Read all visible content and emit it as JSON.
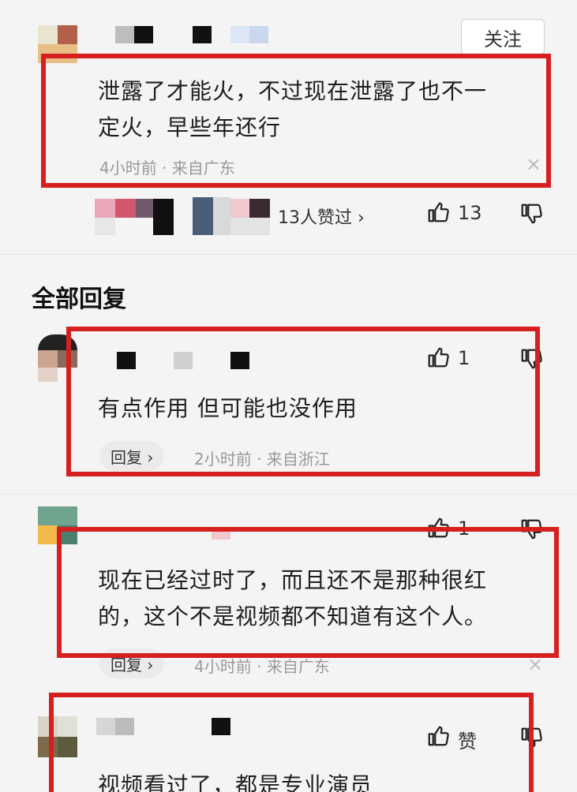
{
  "header": {
    "follow_label": "关注"
  },
  "main_comment": {
    "text_line1": "泄露了才能火，不过现在泄露了也不一",
    "text_line2": "定火，早些年还行",
    "meta": "4小时前 · 来自广东",
    "close": "×",
    "liked_by": "13人赞过 ›",
    "like_count": "13"
  },
  "replies_section": {
    "title": "全部回复"
  },
  "replies": [
    {
      "text": "有点作用 但可能也没作用",
      "reply_label": "回复 ›",
      "meta": "2小时前 · 来自浙江",
      "like_count": "1"
    },
    {
      "text_line1": "现在已经过时了，而且还不是那种很红",
      "text_line2": "的，这个不是视频都不知道有这个人。",
      "reply_label": "回复 ›",
      "meta": "4小时前 · 来自广东",
      "like_count": "1",
      "close": "×"
    },
    {
      "text": "视频看过了，都是专业演员",
      "like_label": "赞"
    }
  ],
  "colors": {
    "highlight_border": "#d61f1f",
    "background": "#f4f4f4"
  },
  "icons": [
    "thumbs-up-icon",
    "thumbs-down-icon",
    "close-icon",
    "chevron-right-icon"
  ]
}
